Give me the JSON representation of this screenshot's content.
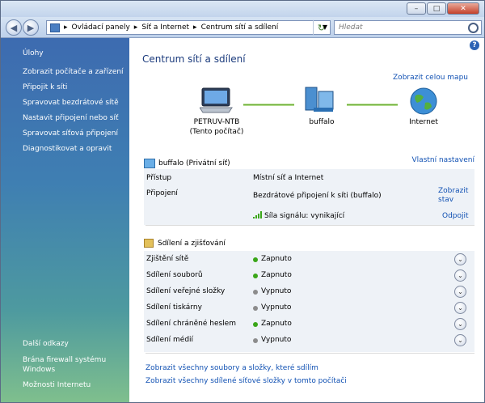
{
  "window": {
    "min_label": "–",
    "max_label": "□",
    "close_label": "✕"
  },
  "address": {
    "back_glyph": "◀",
    "fwd_glyph": "▶",
    "crumbs": [
      "Ovládací panely",
      "Síť a Internet",
      "Centrum sítí a sdílení"
    ],
    "sep": "▸",
    "refresh_glyph": "↻",
    "search_placeholder": "Hledat"
  },
  "sidebar": {
    "title": "Úlohy",
    "items": [
      {
        "label": "Zobrazit počítače a zařízení"
      },
      {
        "label": "Připojit k síti"
      },
      {
        "label": "Spravovat bezdrátové sítě"
      },
      {
        "label": "Nastavit připojení nebo síť"
      },
      {
        "label": "Spravovat síťová připojení"
      },
      {
        "label": "Diagnostikovat a opravit"
      }
    ],
    "other_title": "Další odkazy",
    "other_items": [
      {
        "label": "Brána firewall systému Windows"
      },
      {
        "label": "Možnosti Internetu"
      }
    ]
  },
  "main": {
    "help_glyph": "?",
    "title": "Centrum sítí a sdílení",
    "full_map_link": "Zobrazit celou mapu",
    "map": {
      "computer_name": "PETRUV-NTB",
      "computer_sub": "(Tento počítač)",
      "network_name": "buffalo",
      "internet_label": "Internet"
    },
    "network": {
      "title": "buffalo (Privátní síť)",
      "custom_link": "Vlastní nastavení",
      "access_label": "Přístup",
      "access_value": "Místní síť a Internet",
      "connection_label": "Připojení",
      "connection_value": "Bezdrátové připojení k síti (buffalo)",
      "show_status_link": "Zobrazit stav",
      "signal_text": "Síla signálu: vynikající",
      "disconnect_link": "Odpojit"
    },
    "sharing": {
      "title": "Sdílení a zjišťování",
      "rows": [
        {
          "label": "Zjištění sítě",
          "value": "Zapnuto",
          "on": true
        },
        {
          "label": "Sdílení souborů",
          "value": "Zapnuto",
          "on": true
        },
        {
          "label": "Sdílení veřejné složky",
          "value": "Vypnuto",
          "on": false
        },
        {
          "label": "Sdílení tiskárny",
          "value": "Vypnuto",
          "on": false
        },
        {
          "label": "Sdílení chráněné heslem",
          "value": "Zapnuto",
          "on": true
        },
        {
          "label": "Sdílení médií",
          "value": "Vypnuto",
          "on": false
        }
      ],
      "chevron_glyph": "⌄",
      "on_color": "#3aa619",
      "off_color": "#8c8c8c"
    },
    "bottom_links": [
      "Zobrazit všechny soubory a složky, které sdílím",
      "Zobrazit všechny sdílené síťové složky v tomto počítači"
    ]
  }
}
